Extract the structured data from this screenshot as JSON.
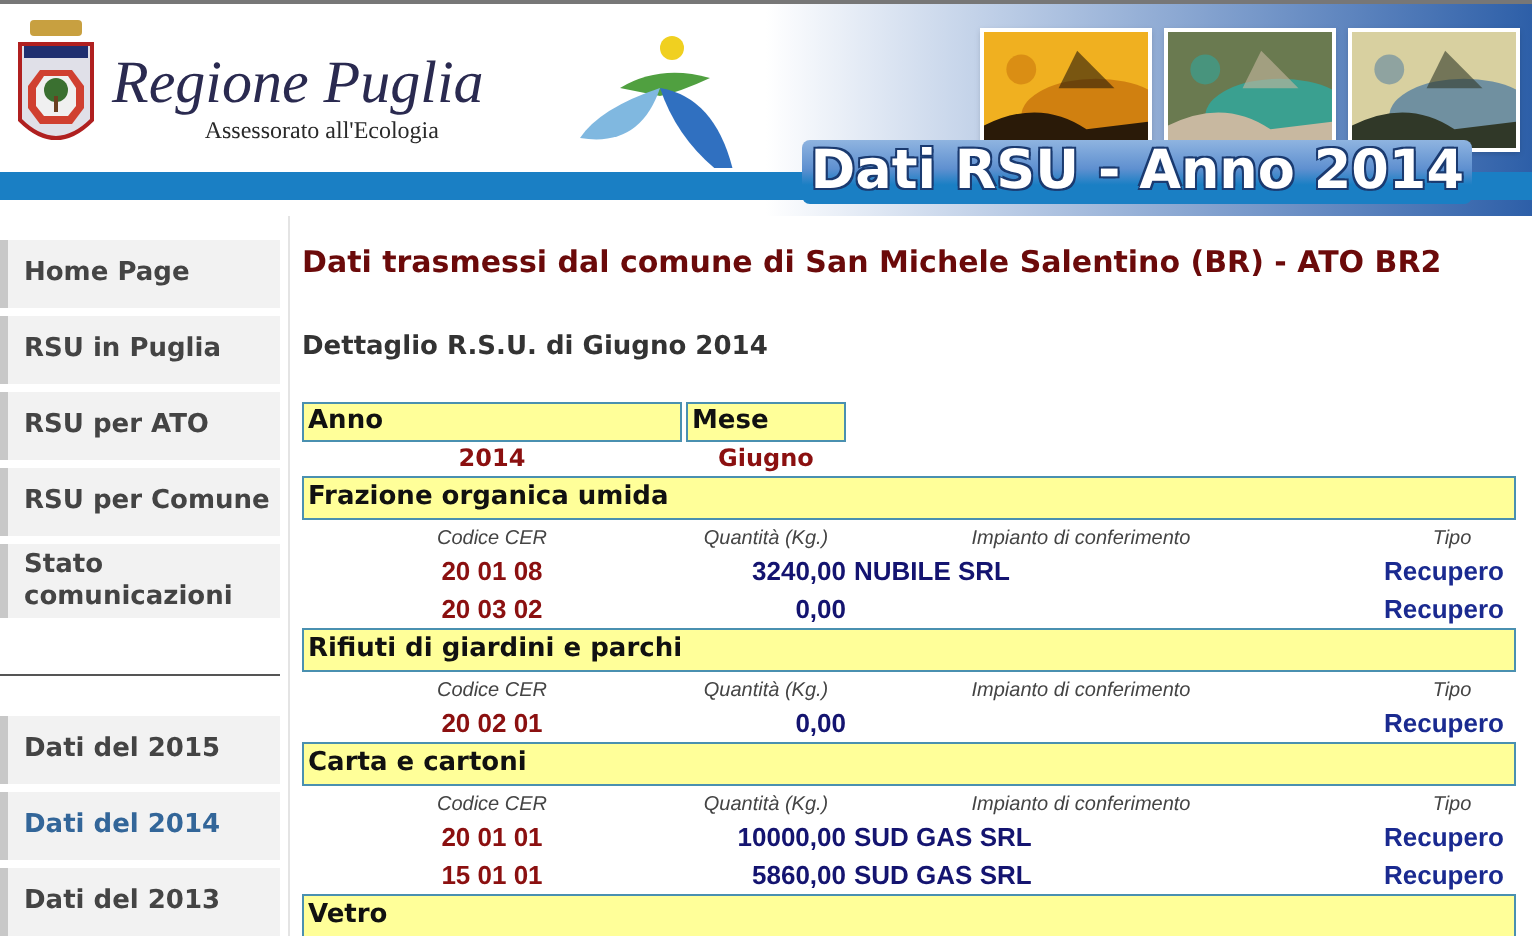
{
  "header": {
    "title": "Regione Puglia",
    "subtitle": "Assessorato all'Ecologia",
    "banner_title": "Dati RSU - Anno 2014"
  },
  "sidebar": {
    "nav_items": [
      {
        "label": "Home Page",
        "selected": false
      },
      {
        "label": "RSU in Puglia",
        "selected": false
      },
      {
        "label": "RSU per ATO",
        "selected": false
      },
      {
        "label": "RSU per Comune",
        "selected": false
      },
      {
        "label": "Stato comunicazioni",
        "selected": false
      }
    ],
    "year_items": [
      {
        "label": "Dati del 2015",
        "selected": false
      },
      {
        "label": "Dati del 2014",
        "selected": true
      },
      {
        "label": "Dati del 2013",
        "selected": false
      }
    ]
  },
  "content": {
    "title": "Dati trasmessi dal comune di San Michele Salentino (BR) - ATO BR2",
    "subtitle": "Dettaglio R.S.U. di Giugno 2014",
    "period": {
      "columns": [
        "Anno",
        "Mese"
      ],
      "values": [
        "2014",
        "Giugno"
      ]
    },
    "sections": [
      {
        "name": "Frazione organica umida",
        "column_labels": [
          "Codice CER",
          "Quantità (Kg.)",
          "Impianto di conferimento",
          "Tipo"
        ],
        "rows": [
          {
            "code": "20 01 08",
            "quantity": "3240,00",
            "plant": "NUBILE SRL",
            "type": "Recupero"
          },
          {
            "code": "20 03 02",
            "quantity": "0,00",
            "type": "Recupero"
          }
        ]
      },
      {
        "name": "Rifiuti di giardini e parchi",
        "column_labels": [
          "Codice CER",
          "Quantità (Kg.)",
          "Impianto di conferimento",
          "Tipo"
        ],
        "rows": [
          {
            "code": "20 02 01",
            "quantity": "0,00",
            "type": "Recupero"
          }
        ]
      },
      {
        "name": "Carta e cartoni",
        "column_labels": [
          "Codice CER",
          "Quantità (Kg.)",
          "Impianto di conferimento",
          "Tipo"
        ],
        "rows": [
          {
            "code": "20 01 01",
            "quantity": "10000,00",
            "plant": "SUD GAS SRL",
            "type": "Recupero"
          },
          {
            "code": "15 01 01",
            "quantity": "5860,00",
            "plant": "SUD GAS SRL",
            "type": "Recupero"
          }
        ]
      },
      {
        "name": "Vetro"
      }
    ]
  }
}
